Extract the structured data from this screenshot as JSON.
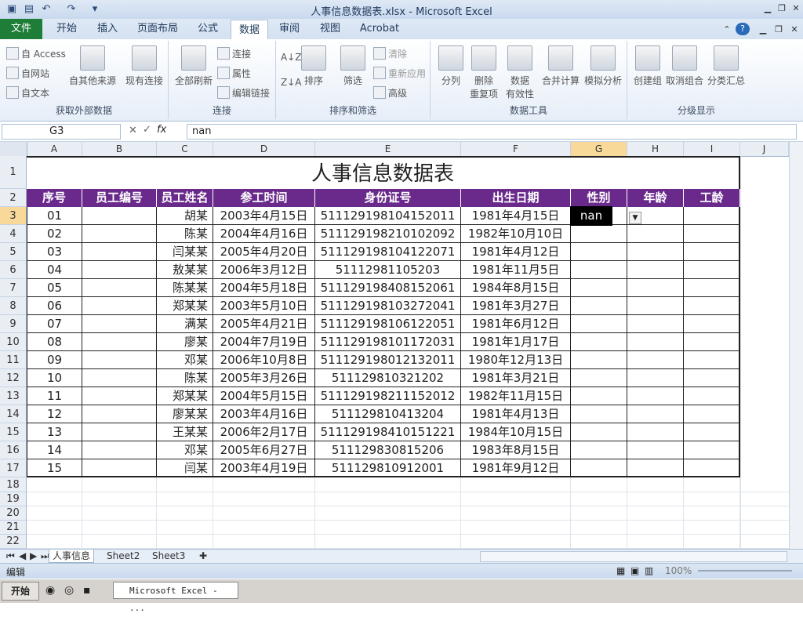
{
  "window": {
    "title": "人事信息数据表.xlsx - Microsoft Excel"
  },
  "tabs": [
    "文件",
    "开始",
    "插入",
    "页面布局",
    "公式",
    "数据",
    "审阅",
    "视图",
    "Acrobat"
  ],
  "ribbon": {
    "groups": {
      "external": {
        "label": "获取外部数据",
        "access": "自 Access",
        "web": "自网站",
        "text": "自文本",
        "other": "自其他来源",
        "existing": "现有连接"
      },
      "connections": {
        "label": "连接",
        "refresh": "全部刷新",
        "conn": "连接",
        "props": "属性",
        "edit_links": "编辑链接"
      },
      "sort_filter": {
        "label": "排序和筛选",
        "sort": "排序",
        "filter": "筛选",
        "clear": "清除",
        "reapply": "重新应用",
        "advanced": "高级"
      },
      "data_tools": {
        "label": "数据工具",
        "split": "分列",
        "remove_dup_1": "删除",
        "remove_dup_2": "重复项",
        "validation_1": "数据",
        "validation_2": "有效性",
        "consolidate": "合并计算",
        "whatif": "模拟分析"
      },
      "outline": {
        "label": "分级显示",
        "group": "创建组",
        "ungroup": "取消组合",
        "subtotal": "分类汇总"
      }
    }
  },
  "formula_bar": {
    "name_box": "G3",
    "formula": "nan"
  },
  "columns": [
    "A",
    "B",
    "C",
    "D",
    "E",
    "F",
    "G",
    "H",
    "I",
    "J"
  ],
  "rows": [
    "1",
    "2",
    "3",
    "4",
    "5",
    "6",
    "7",
    "8",
    "9",
    "10",
    "11",
    "12",
    "13",
    "14",
    "15",
    "16",
    "17",
    "18",
    "19",
    "20",
    "21",
    "22"
  ],
  "sheet": {
    "title": "人事信息数据表",
    "headers": [
      "序号",
      "员工编号",
      "员工姓名",
      "参工时间",
      "身份证号",
      "出生日期",
      "性别",
      "年龄",
      "工龄"
    ],
    "active_cell_value": "nan",
    "records": [
      [
        "01",
        "",
        "胡某",
        "2003年4月15日",
        "511129198104152011",
        "1981年4月15日"
      ],
      [
        "02",
        "",
        "陈某",
        "2004年4月16日",
        "511129198210102092",
        "1982年10月10日"
      ],
      [
        "03",
        "",
        "闫某某",
        "2005年4月20日",
        "511129198104122071",
        "1981年4月12日"
      ],
      [
        "04",
        "",
        "敖某某",
        "2006年3月12日",
        "51112981105203",
        "1981年11月5日"
      ],
      [
        "05",
        "",
        "陈某某",
        "2004年5月18日",
        "511129198408152061",
        "1984年8月15日"
      ],
      [
        "06",
        "",
        "郑某某",
        "2003年5月10日",
        "511129198103272041",
        "1981年3月27日"
      ],
      [
        "07",
        "",
        "满某",
        "2005年4月21日",
        "511129198106122051",
        "1981年6月12日"
      ],
      [
        "08",
        "",
        "廖某",
        "2004年7月19日",
        "511129198101172031",
        "1981年1月17日"
      ],
      [
        "09",
        "",
        "邓某",
        "2006年10月8日",
        "511129198012132011",
        "1980年12月13日"
      ],
      [
        "10",
        "",
        "陈某",
        "2005年3月26日",
        "51112981032120​2",
        "1981年3月21日"
      ],
      [
        "11",
        "",
        "郑某某",
        "2004年5月15日",
        "511129198211152012",
        "1982年11月15日"
      ],
      [
        "12",
        "",
        "廖某某",
        "2003年4月16日",
        "51112981041320​4",
        "1981年4月13日"
      ],
      [
        "13",
        "",
        "王某某",
        "2006年2月17日",
        "511129198410151221",
        "1984年10月15日"
      ],
      [
        "14",
        "",
        "邓某",
        "2005年6月27日",
        "51112983081520​6",
        "1983年8月15日"
      ],
      [
        "15",
        "",
        "闫某",
        "2003年4月19日",
        "51112981091200​1",
        "1981年9月12日"
      ]
    ]
  },
  "sheet_tabs": [
    "人事信息",
    "Sheet2",
    "Sheet3"
  ],
  "status": {
    "mode": "编辑",
    "zoom": "100%"
  },
  "taskbar": {
    "start": "开始",
    "task": "Microsoft Excel - ..."
  }
}
